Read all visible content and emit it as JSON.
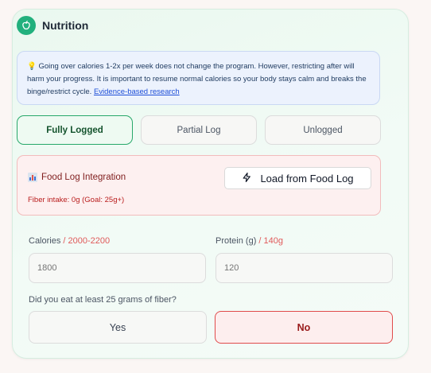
{
  "section": {
    "title": "Nutrition",
    "icon": "apple-icon",
    "accent": "#22b07d"
  },
  "info": {
    "emoji": "💡",
    "text": "Going over calories 1-2x per week does not change the program. However, restricting after will harm your progress. It is important to resume normal calories so your body stays calm and breaks the binge/restrict cycle.",
    "link": "Evidence-based research"
  },
  "log_status": {
    "options": [
      "Fully Logged",
      "Partial Log",
      "Unlogged"
    ],
    "selected": "Fully Logged"
  },
  "food_log": {
    "icon": "bar-chart-icon",
    "title": "Food Log Integration",
    "fiber_text": "Fiber intake: 0g (Goal: 25g+)",
    "load_button": "Load from Food Log",
    "load_icon": "lightning-icon"
  },
  "calories": {
    "label": "Calories",
    "range": "/ 2000-2200",
    "placeholder": "1800"
  },
  "protein": {
    "label": "Protein (g)",
    "range": "/ 140g",
    "placeholder": "120"
  },
  "fiber_question": {
    "text": "Did you eat at least 25 grams of fiber?",
    "yes": "Yes",
    "no": "No",
    "selected": "No"
  },
  "colors": {
    "success": "#27a86a",
    "danger": "#e04b4b",
    "info_bg": "#ecf2fd"
  }
}
